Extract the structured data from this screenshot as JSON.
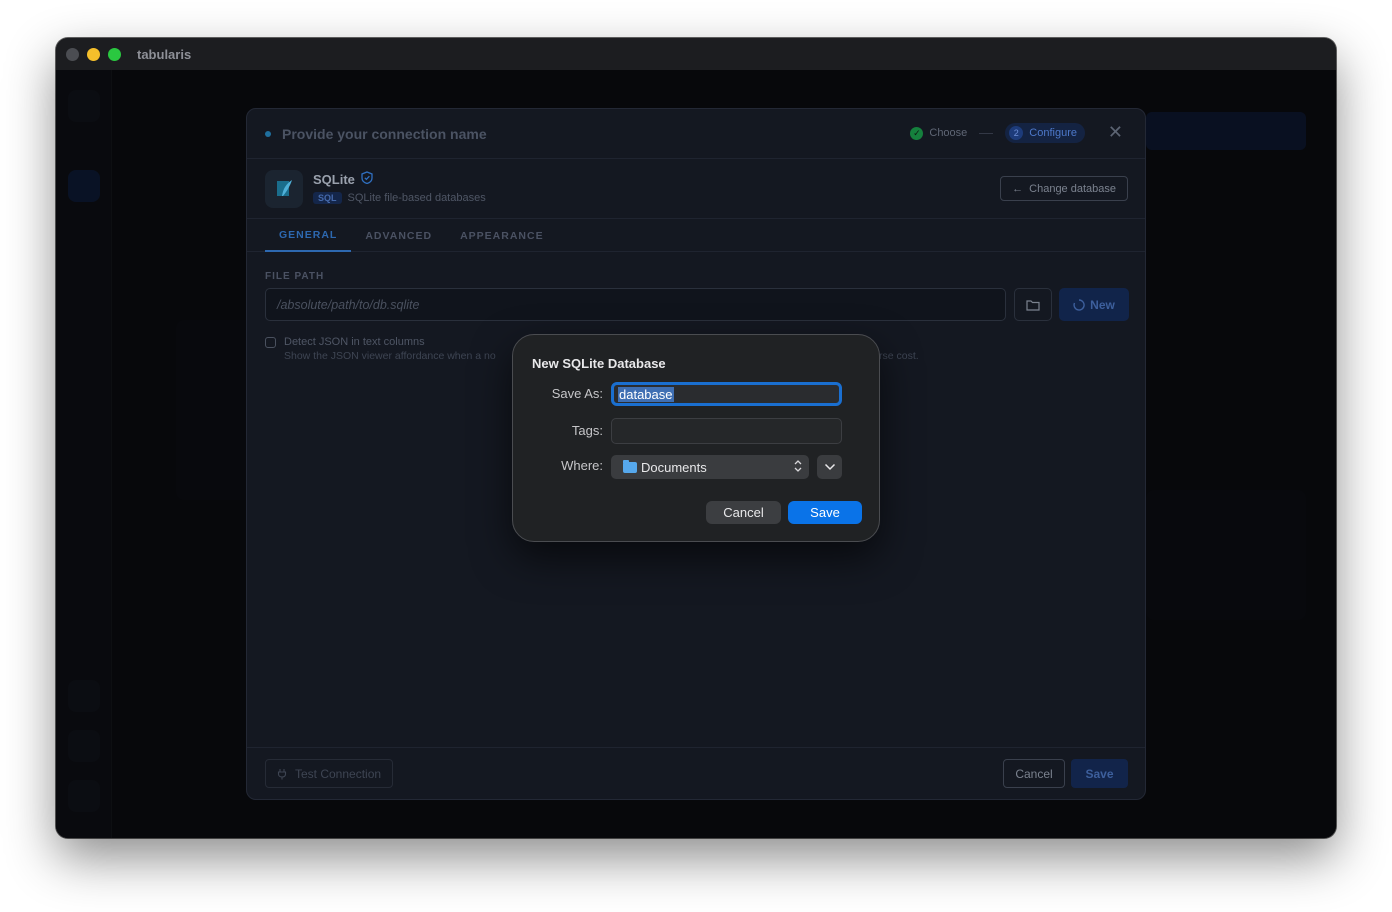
{
  "window": {
    "title": "tabularis"
  },
  "modal": {
    "name_placeholder": "Provide your connection name",
    "steps": [
      {
        "label": "Choose",
        "state": "done"
      },
      {
        "number": "2",
        "label": "Configure",
        "state": "active"
      }
    ],
    "database": {
      "name": "SQLite",
      "badge": "SQL",
      "description": "SQLite file-based databases",
      "change_label": "Change database"
    },
    "tabs": [
      {
        "label": "GENERAL",
        "active": true
      },
      {
        "label": "ADVANCED",
        "active": false
      },
      {
        "label": "APPEARANCE",
        "active": false
      }
    ],
    "file_path": {
      "label": "FILE PATH",
      "placeholder": "/absolute/path/to/db.sqlite",
      "new_label": "New"
    },
    "detect_json": {
      "label": "Detect JSON in text columns",
      "description": "Show the JSON viewer affordance when a no",
      "description_tail": "rse cost."
    },
    "footer": {
      "test_label": "Test Connection",
      "cancel_label": "Cancel",
      "save_label": "Save"
    }
  },
  "save_sheet": {
    "title": "New SQLite Database",
    "save_as_label": "Save As:",
    "save_as_value": "database",
    "tags_label": "Tags:",
    "where_label": "Where:",
    "where_value": "Documents",
    "cancel_label": "Cancel",
    "save_label": "Save"
  },
  "colors": {
    "accent": "#0a73e8",
    "app_accent": "#2d68b0",
    "success": "#15803d"
  }
}
